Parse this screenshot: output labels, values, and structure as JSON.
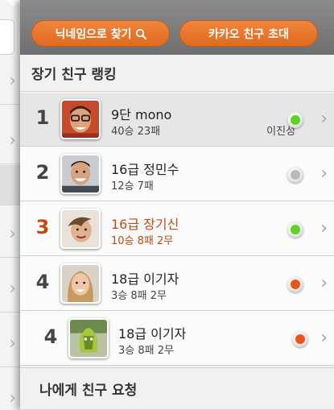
{
  "colors": {
    "accent": "#e8782c",
    "highlight_text": "#c84812",
    "status_green": "#5ad322",
    "status_gray": "#b9b9b9",
    "status_orange": "#e8561b"
  },
  "header": {
    "nickname_search_label": "닉네임으로 찾기",
    "nickname_search_icon": "search-icon",
    "kakao_invite_label": "카카오 친구 초대"
  },
  "ranking": {
    "title": "장기 친구 랭킹",
    "rows": [
      {
        "rank": "1",
        "name": "9단 mono",
        "record": "40승 23패",
        "friend": "이진성",
        "status": "green"
      },
      {
        "rank": "2",
        "name": "16급 정민수",
        "record": "12승 7패",
        "friend": "",
        "status": "gray"
      },
      {
        "rank": "3",
        "name": "16급 장기신",
        "record": "10승 8패 2무",
        "friend": "",
        "status": "green"
      },
      {
        "rank": "4",
        "name": "18급 이기자",
        "record": "3승 8패 2무",
        "friend": "",
        "status": "orange"
      },
      {
        "rank": "4",
        "name": "18급 이기자",
        "record": "3승 8패 2무",
        "friend": "",
        "status": "orange"
      }
    ]
  },
  "requests": {
    "title": "나에게 친구 요청"
  }
}
